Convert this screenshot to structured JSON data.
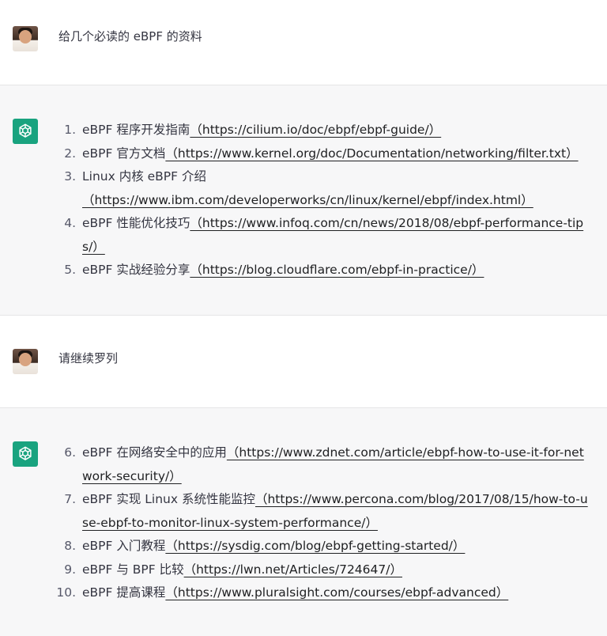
{
  "conversation": {
    "turns": [
      {
        "role": "user",
        "avatar": "user-photo",
        "text": "给几个必读的 eBPF 的资料"
      },
      {
        "role": "assistant",
        "avatar": "openai-logo-icon",
        "items": [
          {
            "num": "1.",
            "title": "eBPF 程序开发指南",
            "link": "（https://cilium.io/doc/ebpf/ebpf-guide/）"
          },
          {
            "num": "2.",
            "title": "eBPF 官方文档",
            "link": "（https://www.kernel.org/doc/Documentation/networking/filter.txt）"
          },
          {
            "num": "3.",
            "title": "Linux 内核 eBPF 介绍",
            "link": "（https://www.ibm.com/developerworks/cn/linux/kernel/ebpf/index.html）"
          },
          {
            "num": "4.",
            "title": "eBPF 性能优化技巧",
            "link": "（https://www.infoq.com/cn/news/2018/08/ebpf-performance-tips/）"
          },
          {
            "num": "5.",
            "title": "eBPF 实战经验分享",
            "link": "（https://blog.cloudflare.com/ebpf-in-practice/）"
          }
        ]
      },
      {
        "role": "user",
        "avatar": "user-photo",
        "text": "请继续罗列"
      },
      {
        "role": "assistant",
        "avatar": "openai-logo-icon",
        "items": [
          {
            "num": "6.",
            "title": "eBPF 在网络安全中的应用",
            "link": "（https://www.zdnet.com/article/ebpf-how-to-use-it-for-network-security/）"
          },
          {
            "num": "7.",
            "title": "eBPF 实现 Linux 系统性能监控",
            "link": "（https://www.percona.com/blog/2017/08/15/how-to-use-ebpf-to-monitor-linux-system-performance/）"
          },
          {
            "num": "8.",
            "title": "eBPF 入门教程",
            "link": "（https://sysdig.com/blog/ebpf-getting-started/）"
          },
          {
            "num": "9.",
            "title": "eBPF 与 BPF 比较",
            "link": "（https://lwn.net/Articles/724647/）"
          },
          {
            "num": "10.",
            "title": "eBPF 提高课程",
            "link": "（https://www.pluralsight.com/courses/ebpf-advanced）"
          }
        ]
      }
    ]
  },
  "colors": {
    "assistant_bg": "#f7f7f8",
    "openai_green": "#19a37f",
    "text": "#343541",
    "divider": "#e5e5e6"
  }
}
